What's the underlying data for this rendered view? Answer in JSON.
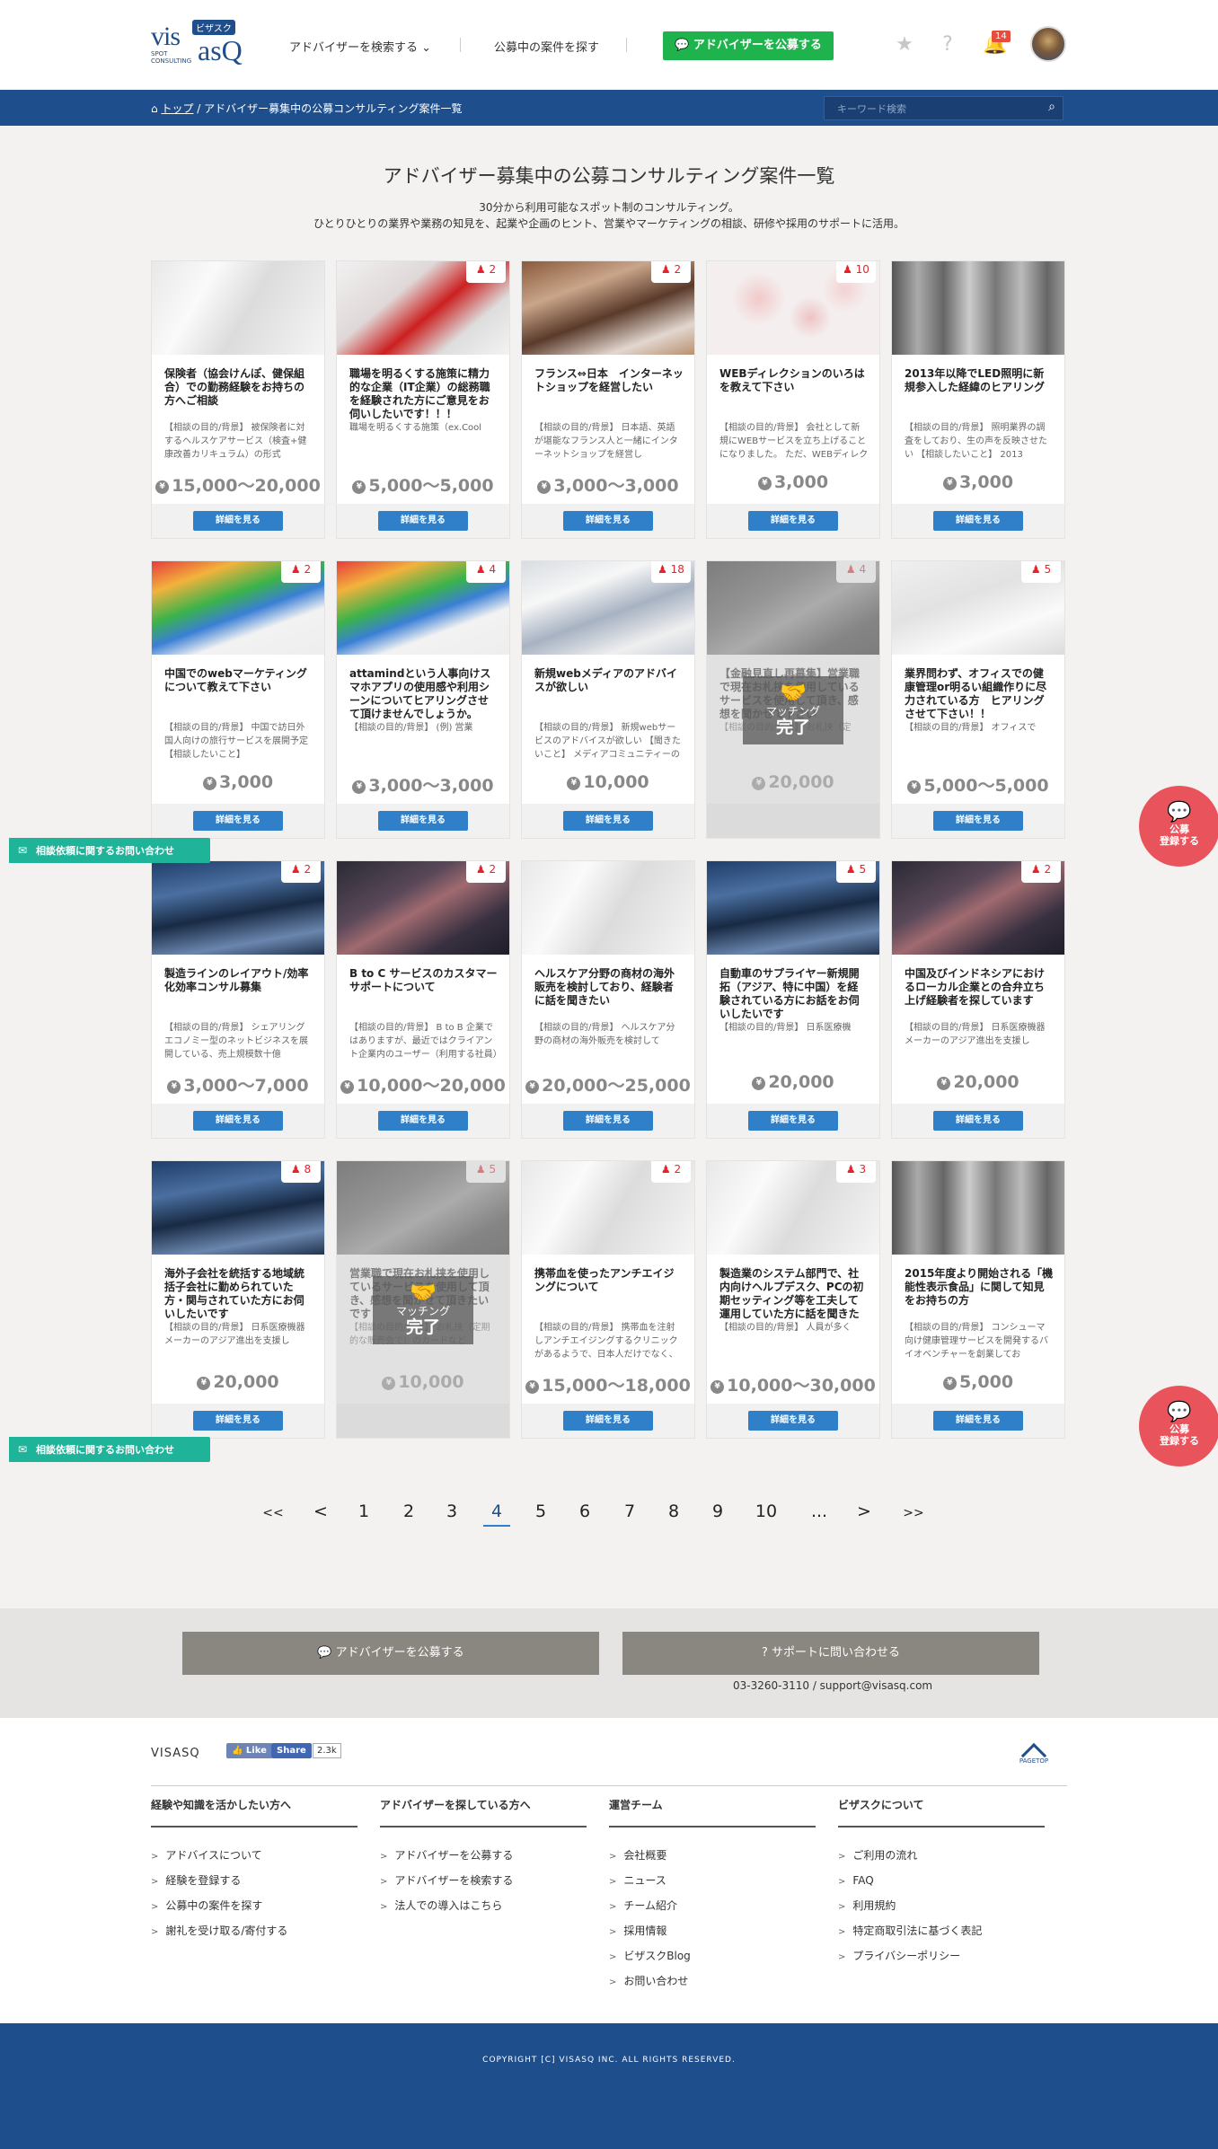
{
  "header": {
    "logo_main": "visasq",
    "logo_kana": "ビザスク",
    "logo_sub": "SPOT CONSULTING",
    "nav_search_advisor": "アドバイザーを検索する ⌄",
    "nav_find_projects": "公募中の案件を探す",
    "publish_button": "💬 アドバイザーを公募する",
    "notification_count": "14"
  },
  "breadcrumb": {
    "home": "トップ",
    "separator": "/",
    "current": "アドバイザー募集中の公募コンサルティング案件一覧"
  },
  "search": {
    "placeholder": "キーワード検索"
  },
  "page": {
    "title": "アドバイザー募集中の公募コンサルティング案件一覧",
    "subtitle_line1": "30分から利用可能なスポット制のコンサルティング。",
    "subtitle_line2": "ひとりひとりの業界や業務の知見を、起業や企画のヒント、営業やマーケティングの相談、研修や採用のサポートに活用。"
  },
  "cards": [
    {
      "title": "保険者（協会けんぽ、健保組合）での勤務経験をお持ちの方へご相談",
      "desc": "【相談の目的/背景】 被保険者に対するヘルスケアサービス（検査+健康改善カリキュラム）の形式",
      "price": "15,000〜20,000",
      "count": "",
      "button": "詳細を見る"
    },
    {
      "title": "職場を明るくする施策に精力的な企業（IT企業）の総務職を経験された方にご意見をお伺いしたいです！！！",
      "desc": "職場を明るくする施策（ex.Cool",
      "price": "5,000〜5,000",
      "count": "2",
      "button": "詳細を見る"
    },
    {
      "title": "フランス⇔日本　インターネットショップを経営したい",
      "desc": "【相談の目的/背景】 日本語、英語が堪能なフランス人と一緒にインターネットショップを経営し",
      "price": "3,000〜3,000",
      "count": "2",
      "button": "詳細を見る"
    },
    {
      "title": "WEBディレクションのいろはを教えて下さい",
      "desc": "【相談の目的/背景】 会社として新規にWEBサービスを立ち上げることになりました。 ただ、WEBディレクションについてな",
      "price": "3,000",
      "count": "10",
      "button": "詳細を見る"
    },
    {
      "title": "2013年以降でLED照明に新規参入した経緯のヒアリング",
      "desc": "【相談の目的/背景】 照明業界の調査をしており、生の声を反映させたい 【相談したいこと】 2013",
      "price": "3,000",
      "count": "",
      "button": "詳細を見る"
    },
    {
      "title": "中国でのwebマーケティングについて教えて下さい",
      "desc": "【相談の目的/背景】 中国で訪日外国人向けの旅行サービスを展開予定 【相談したいこと】",
      "price": "3,000",
      "count": "2",
      "button": "詳細を見る"
    },
    {
      "title": "attamindという人事向けスマホアプリの使用感や利用シーンについてヒアリングさせて頂けませんでしょうか。",
      "desc": "【相談の目的/背景】 (例) 営業",
      "price": "3,000〜3,000",
      "count": "4",
      "button": "詳細を見る"
    },
    {
      "title": "新規webメディアのアドバイスが欲しい",
      "desc": "【相談の目的/背景】 新規webサービスのアドバイスが欲しい 【聞きたいこと】 メディアコミュニティーの立ち上げを企画して",
      "price": "10,000",
      "count": "18",
      "button": "詳細を見る"
    },
    {
      "title": "【金融見直し再募集】営業職で現在お札挟を使用しているサービスを使用して頂き、感想を聞かせて下さい",
      "desc": "【相談の目的/背景】 お札挟（定",
      "price": "20,000",
      "count": "4",
      "button": "",
      "done": true
    },
    {
      "title": "業界問わず、オフィスでの健康管理or明るい組織作りに尽力されている方　ヒアリングさせて下さい！！",
      "desc": "【相談の目的/背景】 オフィスで",
      "price": "5,000〜5,000",
      "count": "5",
      "button": "詳細を見る"
    },
    {
      "title": "製造ラインのレイアウト/効率化効率コンサル募集",
      "desc": "【相談の目的/背景】 シェアリングエコノミー型のネットビジネスを展開している、売上規模数十億",
      "price": "3,000〜7,000",
      "count": "2",
      "button": "詳細を見る"
    },
    {
      "title": "B to C サービスのカスタマーサポートについて",
      "desc": "【相談の目的/背景】 B to B 企業ではありますが、最近ではクライアント企業内のユーザー（利用する社員）まで考える必要があり、",
      "price": "10,000〜20,000",
      "count": "2",
      "button": "詳細を見る"
    },
    {
      "title": "ヘルスケア分野の商材の海外販売を検討しており、経験者に話を聞きたい",
      "desc": "【相談の目的/背景】 ヘルスケア分野の商材の海外販売を検討して",
      "price": "20,000〜25,000",
      "count": "",
      "button": "詳細を見る"
    },
    {
      "title": "自動車のサプライヤー新規開拓（アジア、特に中国）を経験されている方にお話をお伺いしたいです",
      "desc": "【相談の目的/背景】 日系医療機",
      "price": "20,000",
      "count": "5",
      "button": "詳細を見る"
    },
    {
      "title": "中国及びインドネシアにおけるローカル企業との合弁立ち上げ経験者を探しています",
      "desc": "【相談の目的/背景】 日系医療機器メーカーのアジア進出を支援し",
      "price": "20,000",
      "count": "2",
      "button": "詳細を見る"
    },
    {
      "title": "海外子会社を統括する地域統括子会社に勤められていた方・関与されていた方にお伺いしたいです",
      "desc": "【相談の目的/背景】 日系医療機器メーカーのアジア進出を支援し",
      "price": "20,000",
      "count": "8",
      "button": "詳細を見る"
    },
    {
      "title": "営業職で現在お札挟を使用しているサービスを使用して頂き、感想を聞かせて頂きたいです",
      "desc": "【相談の目的/背景】 お札挟（定期的な販売会で）のカードなど",
      "price": "10,000",
      "count": "5",
      "button": "",
      "done": true
    },
    {
      "title": "携帯血を使ったアンチエイジングについて",
      "desc": "【相談の目的/背景】 携帯血を注射しアンチエイジングするクリニックがあるようで、日本人だけでなく、外国人も日本に来て受けて",
      "price": "15,000〜18,000",
      "count": "2",
      "button": "詳細を見る"
    },
    {
      "title": "製造業のシステム部門で、社内向けヘルプデスク、PCの初期セッティング等を工夫して運用していた方に話を聞きたい",
      "desc": "【相談の目的/背景】 人員が多く",
      "price": "10,000〜30,000",
      "count": "3",
      "button": "詳細を見る"
    },
    {
      "title": "2015年度より開始される「機能性表示食品」に関して知見をお持ちの方",
      "desc": "【相談の目的/背景】 コンシューマ向け健康管理サービスを開発するバイオベンチャーを創業してお",
      "price": "5,000",
      "count": "",
      "button": "詳細を見る"
    }
  ],
  "done_overlay": {
    "line1": "マッチング",
    "line2": "完了"
  },
  "contact_tab": "相談依頼に関するお問い合わせ",
  "register_circle": {
    "line1": "公募",
    "line2": "登録する"
  },
  "pagination": [
    "<<",
    "<",
    "1",
    "2",
    "3",
    "4",
    "5",
    "6",
    "7",
    "8",
    "9",
    "10",
    "...",
    ">",
    ">>"
  ],
  "pagination_current": "4",
  "cta": {
    "publish": "💬  アドバイザーを公募する",
    "support": "?  サポートに問い合わせる",
    "contact_info": "03-3260-3110 / support@visasq.com"
  },
  "footer": {
    "logo": "VISASQ",
    "fb_like": "👍 Like",
    "fb_share": "Share",
    "fb_count": "2.3k",
    "pagetop": "PAGETOP",
    "columns": [
      {
        "heading": "経験や知識を活かしたい方へ",
        "items": [
          "アドバイスについて",
          "経験を登録する",
          "公募中の案件を探す",
          "謝礼を受け取る/寄付する"
        ]
      },
      {
        "heading": "アドバイザーを探している方へ",
        "items": [
          "アドバイザーを公募する",
          "アドバイザーを検索する",
          "法人での導入はこちら"
        ]
      },
      {
        "heading": "運営チーム",
        "items": [
          "会社概要",
          "ニュース",
          "チーム紹介",
          "採用情報",
          "ビザスクBlog",
          "お問い合わせ"
        ]
      },
      {
        "heading": "ビザスクについて",
        "items": [
          "ご利用の流れ",
          "FAQ",
          "利用規約",
          "特定商取引法に基づく表記",
          "プライバシーポリシー"
        ]
      }
    ],
    "copyright": "COPYRIGHT [C] VISASQ INC. ALL RIGHTS RESERVED."
  }
}
